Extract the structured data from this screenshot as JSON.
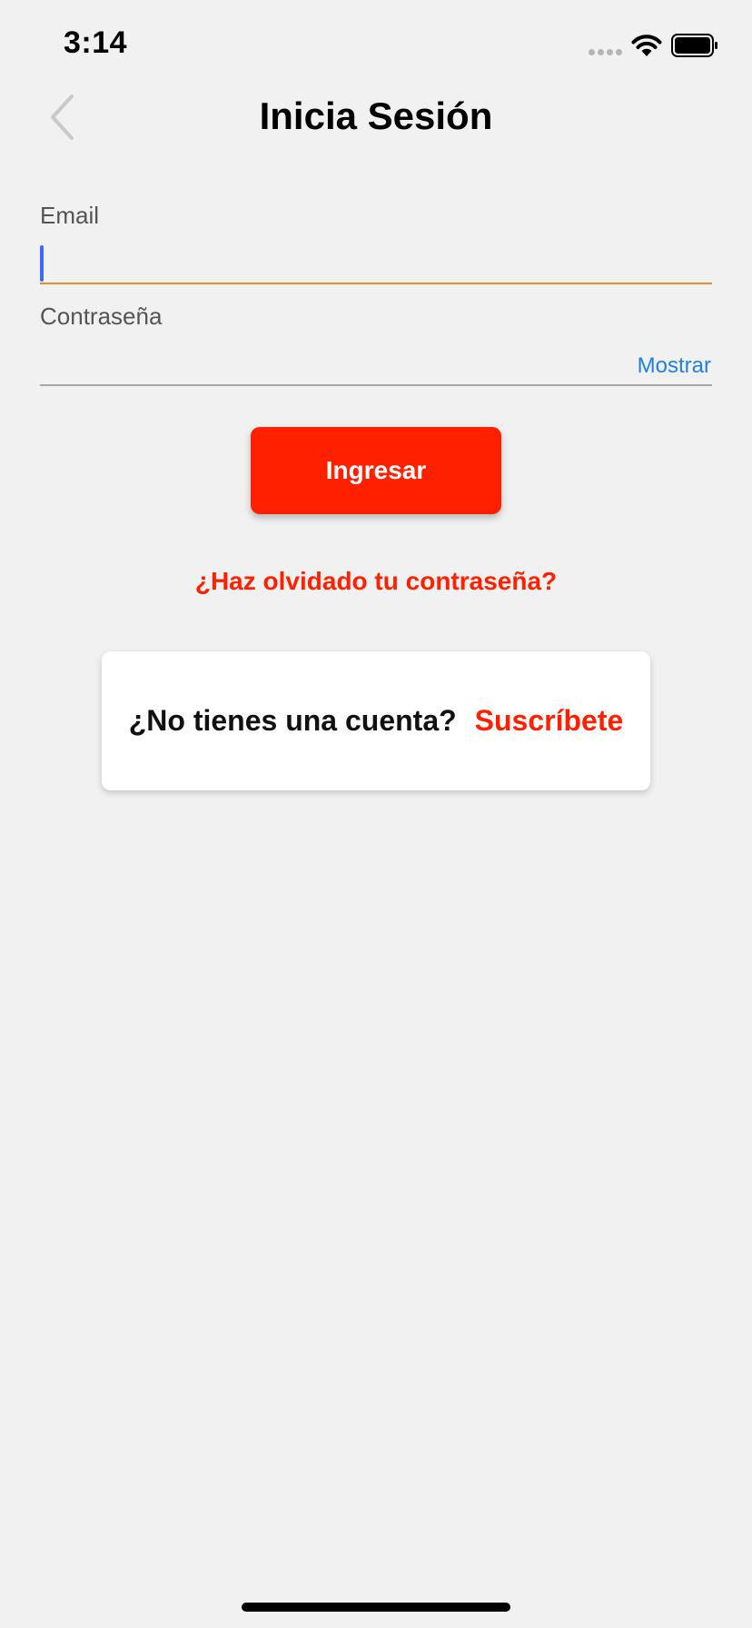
{
  "status_bar": {
    "time": "3:14",
    "icons": [
      "signal-icon",
      "wifi-icon",
      "battery-icon"
    ]
  },
  "nav": {
    "title": "Inicia Sesión",
    "back_icon": "chevron-left-icon"
  },
  "form": {
    "email": {
      "label": "Email",
      "value": ""
    },
    "password": {
      "label": "Contraseña",
      "value": "",
      "show_label": "Mostrar"
    }
  },
  "actions": {
    "login_label": "Ingresar",
    "forgot_label": "¿Haz olvidado tu contraseña?"
  },
  "signup": {
    "prompt": "¿No tienes una cuenta?",
    "link_label": "Suscríbete"
  },
  "colors": {
    "background": "#f1f1f1",
    "accent": "#ff2000",
    "link_blue": "#1f80e5",
    "focus_underline": "#e08a2c",
    "caret": "#3c6cf0"
  }
}
